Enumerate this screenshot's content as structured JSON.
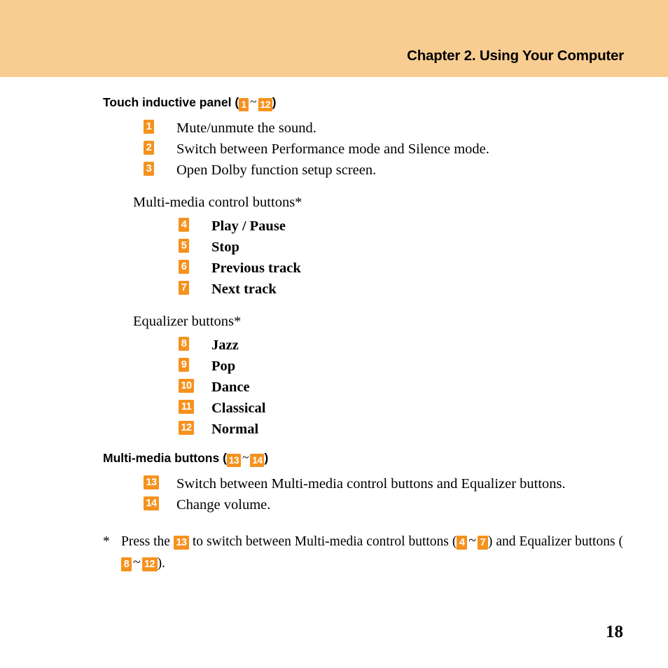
{
  "header": {
    "chapter_title": "Chapter 2. Using Your Computer",
    "banner_color": "#f9cd92"
  },
  "theme": {
    "badge_color": "#f5921e",
    "badge_text_color": "#ffffff"
  },
  "sections": [
    {
      "heading_text": "Touch inductive panel",
      "range_from": "1",
      "range_to": "12",
      "items": [
        {
          "num": "1",
          "text": "Mute/unmute the sound."
        },
        {
          "num": "2",
          "text": "Switch between Performance mode and Silence mode."
        },
        {
          "num": "3",
          "text": "Open Dolby function setup screen."
        }
      ],
      "groups": [
        {
          "label": "Multi-media control buttons*",
          "items": [
            {
              "num": "4",
              "text": "Play / Pause"
            },
            {
              "num": "5",
              "text": "Stop"
            },
            {
              "num": "6",
              "text": "Previous track"
            },
            {
              "num": "7",
              "text": "Next track"
            }
          ]
        },
        {
          "label": "Equalizer buttons*",
          "items": [
            {
              "num": "8",
              "text": "Jazz"
            },
            {
              "num": "9",
              "text": "Pop"
            },
            {
              "num": "10",
              "text": "Dance"
            },
            {
              "num": "11",
              "text": "Classical"
            },
            {
              "num": "12",
              "text": "Normal"
            }
          ]
        }
      ]
    },
    {
      "heading_text": "Multi-media buttons",
      "range_from": "13",
      "range_to": "14",
      "items": [
        {
          "num": "13",
          "text": "Switch between Multi-media control buttons and Equalizer buttons."
        },
        {
          "num": "14",
          "text": "Change volume."
        }
      ]
    }
  ],
  "footnote": {
    "star": "*",
    "part1": "Press the",
    "badge1": "13",
    "part2": "to switch between Multi-media control buttons (",
    "badge2": "4",
    "tilde": "~",
    "badge3": "7",
    "part3": ")",
    "part4": "and Equalizer buttons (",
    "badge4": "8",
    "badge5": "12",
    "part5": ")."
  },
  "page_number": "18"
}
